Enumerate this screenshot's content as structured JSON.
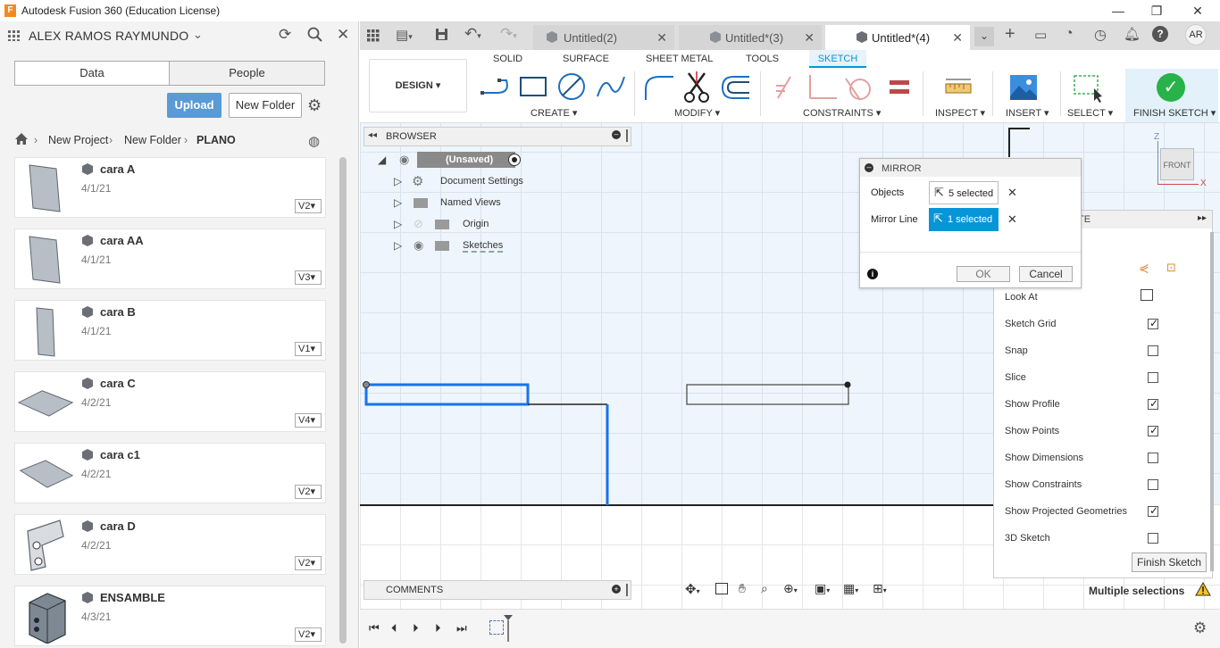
{
  "window": {
    "title": "Autodesk Fusion 360 (Education License)",
    "icon": "fusion-logo-icon"
  },
  "datapanel": {
    "user": "ALEX RAMOS RAYMUNDO",
    "tabs": [
      "Data",
      "People"
    ],
    "upload_label": "Upload",
    "newfolder_label": "New Folder",
    "breadcrumb": [
      "New Project",
      "New Folder",
      "PLANO"
    ],
    "files": [
      {
        "name": "cara A",
        "date": "4/1/21",
        "version": "V2"
      },
      {
        "name": "cara AA",
        "date": "4/1/21",
        "version": "V3"
      },
      {
        "name": "cara B",
        "date": "4/1/21",
        "version": "V1"
      },
      {
        "name": "cara C",
        "date": "4/2/21",
        "version": "V4"
      },
      {
        "name": "cara c1",
        "date": "4/2/21",
        "version": "V2"
      },
      {
        "name": "cara D",
        "date": "4/2/21",
        "version": "V2"
      },
      {
        "name": "ENSAMBLE",
        "date": "4/3/21",
        "version": "V2"
      }
    ]
  },
  "doctabs": [
    {
      "label": "Untitled(2)",
      "active": false
    },
    {
      "label": "Untitled*(3)",
      "active": false
    },
    {
      "label": "Untitled*(4)",
      "active": true
    }
  ],
  "user_initials": "AR",
  "toolbar": {
    "workspace": "DESIGN",
    "tabs": [
      "SOLID",
      "SURFACE",
      "SHEET METAL",
      "TOOLS",
      "SKETCH"
    ],
    "active_tab": "SKETCH",
    "groups": {
      "create": "CREATE",
      "modify": "MODIFY",
      "constraints": "CONSTRAINTS",
      "inspect": "INSPECT",
      "insert": "INSERT",
      "select": "SELECT",
      "finish": "FINISH SKETCH"
    }
  },
  "browser": {
    "title": "BROWSER",
    "root": "(Unsaved)",
    "items": [
      "Document Settings",
      "Named Views",
      "Origin",
      "Sketches"
    ]
  },
  "mirror": {
    "title": "MIRROR",
    "objects_label": "Objects",
    "objects_value": "5 selected",
    "mirrorline_label": "Mirror Line",
    "mirrorline_value": "1 selected",
    "ok_label": "OK",
    "cancel_label": "Cancel"
  },
  "palette": {
    "title_fragment": "TE",
    "rows": [
      {
        "label": "Look At",
        "checked": null
      },
      {
        "label": "Sketch Grid",
        "checked": true
      },
      {
        "label": "Snap",
        "checked": false
      },
      {
        "label": "Slice",
        "checked": false
      },
      {
        "label": "Show Profile",
        "checked": true
      },
      {
        "label": "Show Points",
        "checked": true
      },
      {
        "label": "Show Dimensions",
        "checked": false
      },
      {
        "label": "Show Constraints",
        "checked": false
      },
      {
        "label": "Show Projected Geometries",
        "checked": true
      },
      {
        "label": "3D Sketch",
        "checked": false
      }
    ],
    "finish_label": "Finish Sketch"
  },
  "viewcube": {
    "face": "FRONT",
    "z": "Z",
    "x": "X"
  },
  "comments_label": "COMMENTS",
  "status_text": "Multiple selections",
  "colors": {
    "accent": "#0696d7",
    "selection": "#1a73e8",
    "finish": "#27b24a"
  }
}
